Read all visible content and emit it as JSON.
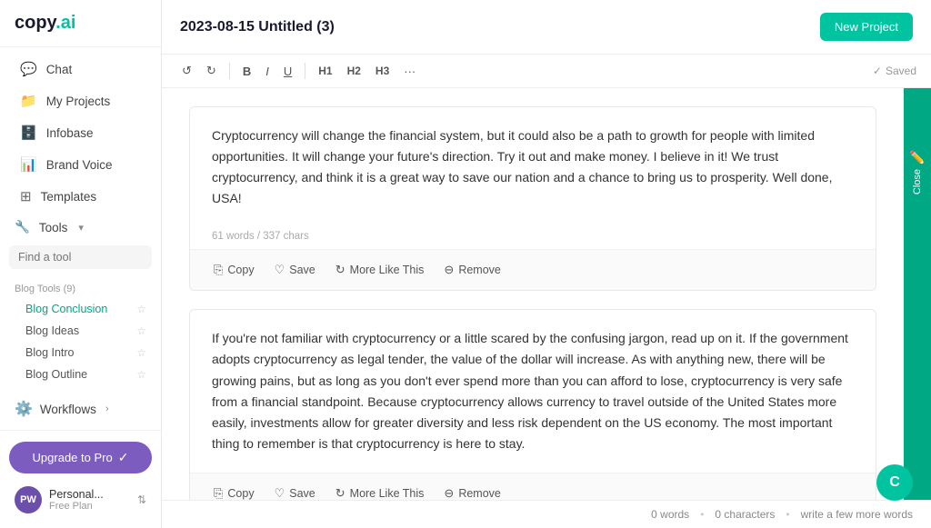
{
  "app": {
    "logo": "copy",
    "logo_dot": ".ai"
  },
  "sidebar": {
    "nav_items": [
      {
        "id": "chat",
        "label": "Chat",
        "icon": "💬"
      },
      {
        "id": "my-projects",
        "label": "My Projects",
        "icon": "📁"
      },
      {
        "id": "infobase",
        "label": "Infobase",
        "icon": "🗄️"
      },
      {
        "id": "brand-voice",
        "label": "Brand Voice",
        "icon": "📊"
      },
      {
        "id": "templates",
        "label": "Templates",
        "icon": "⊞"
      }
    ],
    "tools_label": "Tools",
    "find_tool_placeholder": "Find a tool",
    "blog_tools_section": "Blog Tools (9)",
    "blog_sub_items": [
      {
        "id": "blog-conclusion",
        "label": "Blog Conclusion",
        "active": true
      },
      {
        "id": "blog-ideas",
        "label": "Blog Ideas"
      },
      {
        "id": "blog-intro",
        "label": "Blog Intro"
      },
      {
        "id": "blog-outline",
        "label": "Blog Outline"
      }
    ],
    "workflows_label": "Workflows",
    "upgrade_btn_label": "Upgrade to Pro",
    "user": {
      "initials": "PW",
      "name": "Personal...",
      "plan": "Free Plan"
    }
  },
  "header": {
    "title": "2023-08-15 Untitled (3)",
    "new_project_btn": "New Project"
  },
  "toolbar": {
    "undo": "↺",
    "redo": "↻",
    "bold": "B",
    "italic": "I",
    "underline": "U",
    "h1": "H1",
    "h2": "H2",
    "h3": "H3",
    "more": "···",
    "saved_label": "Saved"
  },
  "close_panel": {
    "label": "Close"
  },
  "content_blocks": [
    {
      "id": "block-1",
      "text": "Cryptocurrency will change the financial system, but it could also be a path to growth for people with limited opportunities. It will change your future's direction. Try it out and make money. I believe in it! We trust cryptocurrency, and think it is a great way to save our nation and a chance to bring us to prosperity. Well done, USA!",
      "meta": "61 words / 337 chars",
      "actions": [
        "Copy",
        "Save",
        "More Like This",
        "Remove"
      ]
    },
    {
      "id": "block-2",
      "text": "If you're not familiar with cryptocurrency or a little scared by the confusing jargon, read up on it. If the government adopts cryptocurrency as legal tender, the value of the dollar will increase. As with anything new, there will be growing pains, but as long as you don't ever spend more than you can afford to lose, cryptocurrency is very safe from a financial standpoint. Because cryptocurrency allows currency to travel outside of the United States more easily, investments allow for greater diversity and less risk dependent on the US economy. The most important thing to remember is that cryptocurrency is here to stay.",
      "meta": "",
      "actions": [
        "Copy",
        "Save",
        "More Like This",
        "Remove"
      ]
    }
  ],
  "status_bar": {
    "words": "0 words",
    "characters": "0 characters",
    "hint": "write a few more words"
  },
  "avatar": {
    "letter": "C"
  }
}
